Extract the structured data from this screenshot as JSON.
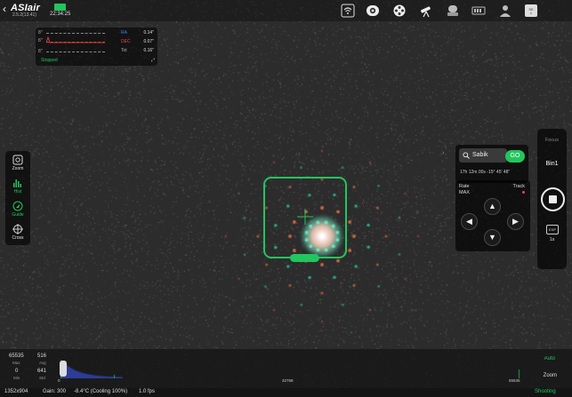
{
  "topbar": {
    "back_icon": "chevron-left-icon",
    "logo": "ASIair",
    "version": "2.5.2(13.41)",
    "time": "22:34:25",
    "battery_color": "#22c55e",
    "icons": [
      "wifi-icon",
      "camera-lens-icon",
      "filter-wheel-icon",
      "telescope-icon",
      "mount-icon",
      "storage-icon",
      "person-icon",
      "settings-icon"
    ]
  },
  "guide": {
    "y_labels": [
      "8''",
      "8''",
      "8''"
    ],
    "ra_label": "RA",
    "ra_value": "0.14\"",
    "dec_label": "DEC",
    "dec_value": "0.07\"",
    "tot_label": "Tot",
    "tot_value": "0.16\"",
    "status": "Stopped",
    "ra_color": "#3b82f6",
    "dec_color": "#ef4444"
  },
  "left_tools": [
    {
      "label": "Zoom",
      "icon": "zoom-frame-icon"
    },
    {
      "label": "Hist",
      "icon": "histogram-icon"
    },
    {
      "label": "Guide",
      "icon": "guide-icon"
    },
    {
      "label": "Cross",
      "icon": "crosshair-icon"
    }
  ],
  "target": {
    "name": "Sabik",
    "go_label": "GO",
    "coords": "17h 12m 00s  -15° 45' 48\""
  },
  "mount": {
    "rate_label": "Rate",
    "rate_value": "MAX",
    "track_label": "Track"
  },
  "exposure": {
    "focus_label": "Focus",
    "bin_label": "Bin1",
    "exp_badge": "EXP",
    "exp_value": "1s"
  },
  "histogram": {
    "max_value": "65535",
    "max_label": "Max",
    "avg_value": "516",
    "avg_label": "Avg",
    "min_value": "0",
    "min_label": "Min",
    "std_value": "641",
    "std_label": "Std",
    "axis_left": "0",
    "axis_mid": "32768",
    "axis_right": "65535",
    "auto_label": "Auto",
    "zoom_label": "Zoom"
  },
  "status_bar": {
    "resolution": "1352x904",
    "gain": "Gain: 300",
    "temperature": "-8.4°C (Cooling 100%)",
    "fps": "1.0 fps",
    "state": "Shooting"
  },
  "colors": {
    "accent": "#22c55e",
    "frame": "#22c55e"
  }
}
